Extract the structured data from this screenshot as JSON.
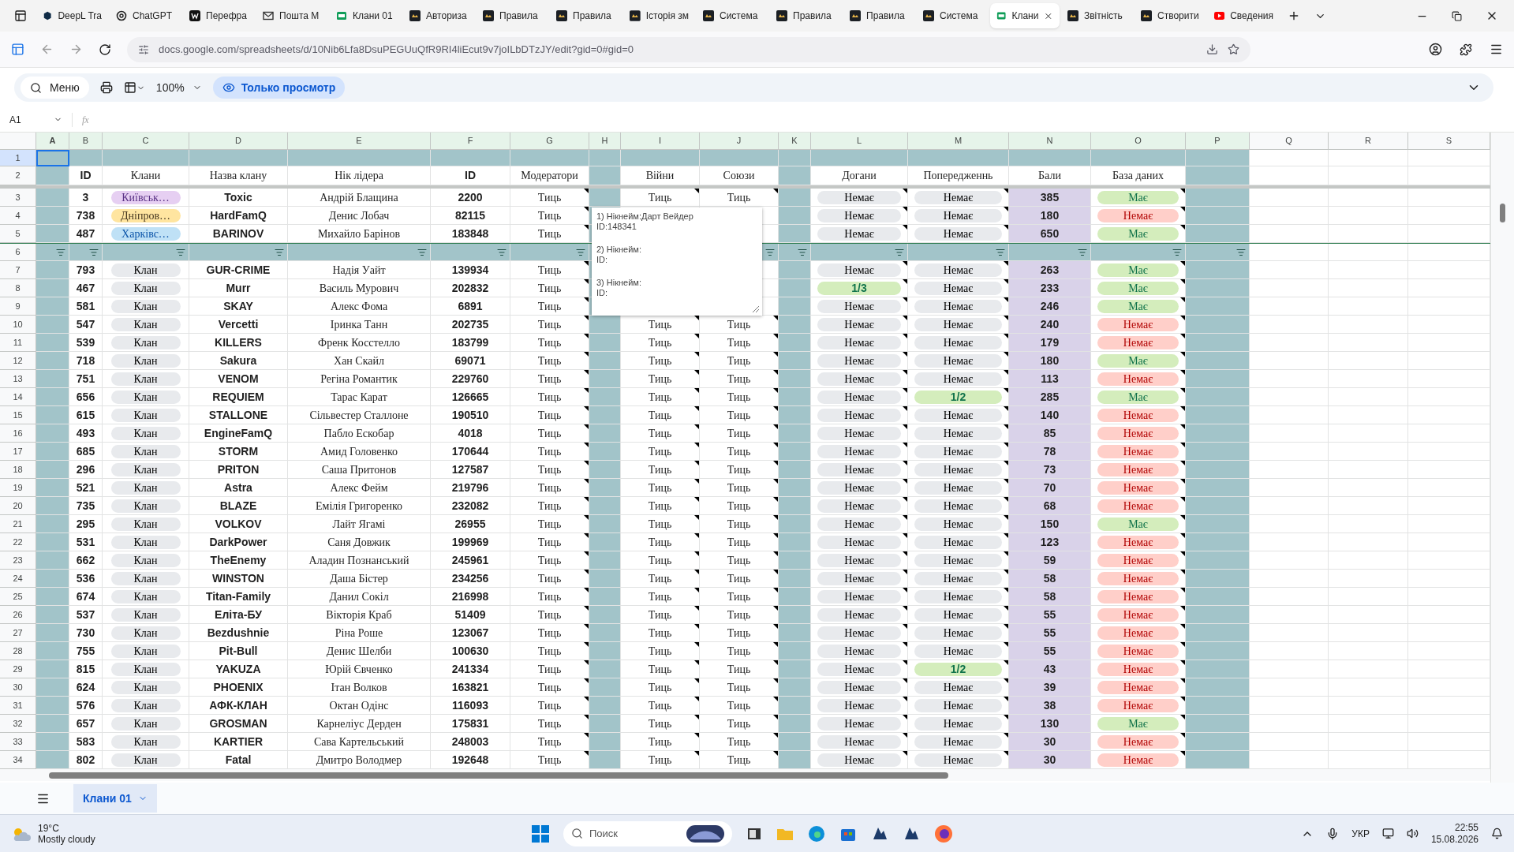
{
  "browser": {
    "tabs": [
      {
        "title": "DeepL Tra",
        "kind": "hexagon",
        "selected": false
      },
      {
        "title": "ChatGPT",
        "kind": "knot",
        "selected": false
      },
      {
        "title": "Перефра",
        "kind": "tile",
        "selected": false
      },
      {
        "title": "Пошта M",
        "kind": "mail",
        "selected": false
      },
      {
        "title": "Клани 01",
        "kind": "sheet",
        "selected": false
      },
      {
        "title": "Авториза",
        "kind": "app",
        "selected": false
      },
      {
        "title": "Правила",
        "kind": "app",
        "selected": false
      },
      {
        "title": "Правила",
        "kind": "app",
        "selected": false
      },
      {
        "title": "Історія зм",
        "kind": "app",
        "selected": false
      },
      {
        "title": "Система",
        "kind": "app",
        "selected": false
      },
      {
        "title": "Правила",
        "kind": "app",
        "selected": false
      },
      {
        "title": "Правила",
        "kind": "app",
        "selected": false
      },
      {
        "title": "Система",
        "kind": "app",
        "selected": false
      },
      {
        "title": "Клани",
        "kind": "sheet",
        "selected": true
      },
      {
        "title": "Звітність",
        "kind": "app",
        "selected": false
      },
      {
        "title": "Створити",
        "kind": "app",
        "selected": false
      },
      {
        "title": "Сведения",
        "kind": "video",
        "selected": false
      }
    ],
    "url": "docs.google.com/spreadsheets/d/10Nib6Lfa8DsuPEGUuQfR9RI4liEcut9v7joILbDTzJY/edit?gid=0#gid=0"
  },
  "toolbar": {
    "menu": "Меню",
    "zoom": "100%",
    "mode": "Только просмотр"
  },
  "formula_bar": {
    "cell": "A1",
    "fx": "fx"
  },
  "sheet": {
    "columns": [
      {
        "letter": "A",
        "highlighted": true,
        "notes": false
      },
      {
        "letter": "B",
        "highlighted": true,
        "notes": false
      },
      {
        "letter": "C",
        "highlighted": true,
        "notes": false
      },
      {
        "letter": "D",
        "highlighted": true,
        "notes": false
      },
      {
        "letter": "E",
        "highlighted": true,
        "notes": false
      },
      {
        "letter": "F",
        "highlighted": true,
        "notes": false
      },
      {
        "letter": "G",
        "highlighted": true,
        "notes": true
      },
      {
        "letter": "H",
        "highlighted": true,
        "notes": false
      },
      {
        "letter": "I",
        "highlighted": true,
        "notes": true
      },
      {
        "letter": "J",
        "highlighted": true,
        "notes": true
      },
      {
        "letter": "K",
        "highlighted": true,
        "notes": false
      },
      {
        "letter": "L",
        "highlighted": true,
        "notes": true
      },
      {
        "letter": "M",
        "highlighted": true,
        "notes": true
      },
      {
        "letter": "N",
        "highlighted": true,
        "notes": false
      },
      {
        "letter": "O",
        "highlighted": true,
        "notes": true
      },
      {
        "letter": "P",
        "highlighted": true,
        "notes": false
      },
      {
        "letter": "Q",
        "highlighted": false,
        "notes": false
      },
      {
        "letter": "R",
        "highlighted": false,
        "notes": false
      },
      {
        "letter": "S",
        "highlighted": false,
        "notes": false
      }
    ],
    "rows": [
      {
        "kind": "band",
        "row": "1"
      },
      {
        "kind": "header",
        "row": "2",
        "labels": {
          "id": "ID",
          "clan": "Клани",
          "clan_name": "Назва клану",
          "leader": "Нік лідера",
          "player_id": "ID",
          "moderators": "Модератори",
          "wars": "Війни",
          "alliances": "Союзи",
          "reprimands": "Догани",
          "warnings": "Попередженнь",
          "points": "Бали",
          "database": "База даних"
        }
      },
      {
        "kind": "data",
        "row": "3",
        "id": "3",
        "clan": {
          "label": "Київськ…",
          "color": "#e6cff2"
        },
        "clan_name": "Toxic",
        "leader": "Андрій Блащина",
        "player_id": "2200",
        "moderators": "Тиць",
        "wars": "Тиць",
        "alliances": "Тиць",
        "reprimands": {
          "text": "Немає",
          "kind": "neutral"
        },
        "warnings": {
          "text": "Немає",
          "kind": "neutral"
        },
        "points": "385",
        "database": {
          "text": "Має",
          "kind": "positive"
        }
      },
      {
        "kind": "data",
        "row": "4",
        "id": "738",
        "clan": {
          "label": "Дніпров…",
          "color": "#ffe5a0"
        },
        "clan_name": "HardFamQ",
        "leader": "Денис Лобач",
        "player_id": "82115",
        "moderators": "Тиць",
        "reprimands": {
          "text": "Немає",
          "kind": "neutral"
        },
        "warnings": {
          "text": "Немає",
          "kind": "neutral"
        },
        "points": "180",
        "database": {
          "text": "Немає",
          "kind": "negative"
        }
      },
      {
        "kind": "data",
        "row": "5",
        "id": "487",
        "clan": {
          "label": "Харківс…",
          "color": "#bfe1f6"
        },
        "clan_name": "BARINOV",
        "leader": "Михайло Барінов",
        "player_id": "183848",
        "moderators": "Тиць",
        "reprimands": {
          "text": "Немає",
          "kind": "neutral"
        },
        "warnings": {
          "text": "Немає",
          "kind": "neutral"
        },
        "points": "650",
        "database": {
          "text": "Має",
          "kind": "positive"
        }
      },
      {
        "kind": "filter",
        "row": "6",
        "filters": [
          true,
          true,
          true,
          true,
          true,
          true,
          true,
          false,
          false,
          true,
          true,
          true,
          true,
          true,
          true,
          true
        ]
      },
      {
        "kind": "data",
        "row": "7",
        "id": "793",
        "clan": {
          "label": "Клан",
          "color": "#e8eaed"
        },
        "clan_name": "GUR-CRIME",
        "leader": "Надія Уайт",
        "player_id": "139934",
        "moderators": "Тиць",
        "reprimands": {
          "text": "Немає",
          "kind": "neutral"
        },
        "warnings": {
          "text": "Немає",
          "kind": "neutral"
        },
        "points": "263",
        "database": {
          "text": "Має",
          "kind": "positive"
        }
      },
      {
        "kind": "data",
        "row": "8",
        "id": "467",
        "clan": {
          "label": "Клан",
          "color": "#e8eaed"
        },
        "clan_name": "Murr",
        "leader": "Василь Мурович",
        "player_id": "202832",
        "moderators": "Тиць",
        "reprimands": {
          "text": "1/3",
          "kind": "positive"
        },
        "warnings": {
          "text": "Немає",
          "kind": "neutral"
        },
        "points": "233",
        "database": {
          "text": "Має",
          "kind": "positive"
        }
      },
      {
        "kind": "data",
        "row": "9",
        "id": "581",
        "clan": {
          "label": "Клан",
          "color": "#e8eaed"
        },
        "clan_name": "SKAY",
        "leader": "Алекс Фома",
        "player_id": "6891",
        "moderators": "Тиць",
        "reprimands": {
          "text": "Немає",
          "kind": "neutral"
        },
        "warnings": {
          "text": "Немає",
          "kind": "neutral"
        },
        "points": "246",
        "database": {
          "text": "Має",
          "kind": "positive"
        }
      },
      {
        "kind": "data",
        "row": "10",
        "id": "547",
        "clan": {
          "label": "Клан",
          "color": "#e8eaed"
        },
        "clan_name": "Vercetti",
        "leader": "Іринка Танн",
        "player_id": "202735",
        "moderators": "Тиць",
        "wars": "Тиць",
        "alliances": "Тиць",
        "reprimands": {
          "text": "Немає",
          "kind": "neutral"
        },
        "warnings": {
          "text": "Немає",
          "kind": "neutral"
        },
        "points": "240",
        "database": {
          "text": "Немає",
          "kind": "negative"
        }
      },
      {
        "kind": "data",
        "row": "11",
        "id": "539",
        "clan": {
          "label": "Клан",
          "color": "#e8eaed"
        },
        "clan_name": "KILLERS",
        "leader": "Френк Косстелло",
        "player_id": "183799",
        "moderators": "Тиць",
        "wars": "Тиць",
        "alliances": "Тиць",
        "reprimands": {
          "text": "Немає",
          "kind": "neutral"
        },
        "warnings": {
          "text": "Немає",
          "kind": "neutral"
        },
        "points": "179",
        "database": {
          "text": "Немає",
          "kind": "negative"
        }
      },
      {
        "kind": "data",
        "row": "12",
        "id": "718",
        "clan": {
          "label": "Клан",
          "color": "#e8eaed"
        },
        "clan_name": "Sakura",
        "leader": "Хан Скайл",
        "player_id": "69071",
        "moderators": "Тиць",
        "wars": "Тиць",
        "alliances": "Тиць",
        "reprimands": {
          "text": "Немає",
          "kind": "neutral"
        },
        "warnings": {
          "text": "Немає",
          "kind": "neutral"
        },
        "points": "180",
        "database": {
          "text": "Має",
          "kind": "positive"
        }
      },
      {
        "kind": "data",
        "row": "13",
        "id": "751",
        "clan": {
          "label": "Клан",
          "color": "#e8eaed"
        },
        "clan_name": "VENOM",
        "leader": "Регіна Романтик",
        "player_id": "229760",
        "moderators": "Тиць",
        "wars": "Тиць",
        "alliances": "Тиць",
        "reprimands": {
          "text": "Немає",
          "kind": "neutral"
        },
        "warnings": {
          "text": "Немає",
          "kind": "neutral"
        },
        "points": "113",
        "database": {
          "text": "Немає",
          "kind": "negative"
        }
      },
      {
        "kind": "data",
        "row": "14",
        "id": "656",
        "clan": {
          "label": "Клан",
          "color": "#e8eaed"
        },
        "clan_name": "REQUIEM",
        "leader": "Тарас Карат",
        "player_id": "126665",
        "moderators": "Тиць",
        "wars": "Тиць",
        "alliances": "Тиць",
        "reprimands": {
          "text": "Немає",
          "kind": "neutral"
        },
        "warnings": {
          "text": "1/2",
          "kind": "positive"
        },
        "points": "285",
        "database": {
          "text": "Має",
          "kind": "positive"
        }
      },
      {
        "kind": "data",
        "row": "15",
        "id": "615",
        "clan": {
          "label": "Клан",
          "color": "#e8eaed"
        },
        "clan_name": "STALLONE",
        "leader": "Сільвестер Сталлоне",
        "player_id": "190510",
        "moderators": "Тиць",
        "wars": "Тиць",
        "alliances": "Тиць",
        "reprimands": {
          "text": "Немає",
          "kind": "neutral"
        },
        "warnings": {
          "text": "Немає",
          "kind": "neutral"
        },
        "points": "140",
        "database": {
          "text": "Немає",
          "kind": "negative"
        }
      },
      {
        "kind": "data",
        "row": "16",
        "id": "493",
        "clan": {
          "label": "Клан",
          "color": "#e8eaed"
        },
        "clan_name": "EngineFamQ",
        "leader": "Пабло Ескобар",
        "player_id": "4018",
        "moderators": "Тиць",
        "wars": "Тиць",
        "alliances": "Тиць",
        "reprimands": {
          "text": "Немає",
          "kind": "neutral"
        },
        "warnings": {
          "text": "Немає",
          "kind": "neutral"
        },
        "points": "85",
        "database": {
          "text": "Немає",
          "kind": "negative"
        }
      },
      {
        "kind": "data",
        "row": "17",
        "id": "685",
        "clan": {
          "label": "Клан",
          "color": "#e8eaed"
        },
        "clan_name": "STORM",
        "leader": "Амид Головенко",
        "player_id": "170644",
        "moderators": "Тиць",
        "wars": "Тиць",
        "alliances": "Тиць",
        "reprimands": {
          "text": "Немає",
          "kind": "neutral"
        },
        "warnings": {
          "text": "Немає",
          "kind": "neutral"
        },
        "points": "78",
        "database": {
          "text": "Немає",
          "kind": "negative"
        }
      },
      {
        "kind": "data",
        "row": "18",
        "id": "296",
        "clan": {
          "label": "Клан",
          "color": "#e8eaed"
        },
        "clan_name": "PRITON",
        "leader": "Саша Притонов",
        "player_id": "127587",
        "moderators": "Тиць",
        "wars": "Тиць",
        "alliances": "Тиць",
        "reprimands": {
          "text": "Немає",
          "kind": "neutral"
        },
        "warnings": {
          "text": "Немає",
          "kind": "neutral"
        },
        "points": "73",
        "database": {
          "text": "Немає",
          "kind": "negative"
        }
      },
      {
        "kind": "data",
        "row": "19",
        "id": "521",
        "clan": {
          "label": "Клан",
          "color": "#e8eaed"
        },
        "clan_name": "Astra",
        "leader": "Алекс Фейм",
        "player_id": "219796",
        "moderators": "Тиць",
        "wars": "Тиць",
        "alliances": "Тиць",
        "reprimands": {
          "text": "Немає",
          "kind": "neutral"
        },
        "warnings": {
          "text": "Немає",
          "kind": "neutral"
        },
        "points": "70",
        "database": {
          "text": "Немає",
          "kind": "negative"
        }
      },
      {
        "kind": "data",
        "row": "20",
        "id": "735",
        "clan": {
          "label": "Клан",
          "color": "#e8eaed"
        },
        "clan_name": "BLAZE",
        "leader": "Емілія Григоренко",
        "player_id": "232082",
        "moderators": "Тиць",
        "wars": "Тиць",
        "alliances": "Тиць",
        "reprimands": {
          "text": "Немає",
          "kind": "neutral"
        },
        "warnings": {
          "text": "Немає",
          "kind": "neutral"
        },
        "points": "68",
        "database": {
          "text": "Немає",
          "kind": "negative"
        }
      },
      {
        "kind": "data",
        "row": "21",
        "id": "295",
        "clan": {
          "label": "Клан",
          "color": "#e8eaed"
        },
        "clan_name": "VOLKOV",
        "leader": "Лайт Ягамі",
        "player_id": "26955",
        "moderators": "Тиць",
        "wars": "Тиць",
        "alliances": "Тиць",
        "reprimands": {
          "text": "Немає",
          "kind": "neutral"
        },
        "warnings": {
          "text": "Немає",
          "kind": "neutral"
        },
        "points": "150",
        "database": {
          "text": "Має",
          "kind": "positive"
        }
      },
      {
        "kind": "data",
        "row": "22",
        "id": "531",
        "clan": {
          "label": "Клан",
          "color": "#e8eaed"
        },
        "clan_name": "DarkPower",
        "leader": "Саня Довжик",
        "player_id": "199969",
        "moderators": "Тиць",
        "wars": "Тиць",
        "alliances": "Тиць",
        "reprimands": {
          "text": "Немає",
          "kind": "neutral"
        },
        "warnings": {
          "text": "Немає",
          "kind": "neutral"
        },
        "points": "123",
        "database": {
          "text": "Немає",
          "kind": "negative"
        }
      },
      {
        "kind": "data",
        "row": "23",
        "id": "662",
        "clan": {
          "label": "Клан",
          "color": "#e8eaed"
        },
        "clan_name": "TheEnemy",
        "leader": "Аладин Познанський",
        "player_id": "245961",
        "moderators": "Тиць",
        "wars": "Тиць",
        "alliances": "Тиць",
        "reprimands": {
          "text": "Немає",
          "kind": "neutral"
        },
        "warnings": {
          "text": "Немає",
          "kind": "neutral"
        },
        "points": "59",
        "database": {
          "text": "Немає",
          "kind": "negative"
        }
      },
      {
        "kind": "data",
        "row": "24",
        "id": "536",
        "clan": {
          "label": "Клан",
          "color": "#e8eaed"
        },
        "clan_name": "WINSTON",
        "leader": "Даша Бістер",
        "player_id": "234256",
        "moderators": "Тиць",
        "wars": "Тиць",
        "alliances": "Тиць",
        "reprimands": {
          "text": "Немає",
          "kind": "neutral"
        },
        "warnings": {
          "text": "Немає",
          "kind": "neutral"
        },
        "points": "58",
        "database": {
          "text": "Немає",
          "kind": "negative"
        }
      },
      {
        "kind": "data",
        "row": "25",
        "id": "674",
        "clan": {
          "label": "Клан",
          "color": "#e8eaed"
        },
        "clan_name": "Titan-Family",
        "leader": "Данил Сокіл",
        "player_id": "216998",
        "moderators": "Тиць",
        "wars": "Тиць",
        "alliances": "Тиць",
        "reprimands": {
          "text": "Немає",
          "kind": "neutral"
        },
        "warnings": {
          "text": "Немає",
          "kind": "neutral"
        },
        "points": "58",
        "database": {
          "text": "Немає",
          "kind": "negative"
        }
      },
      {
        "kind": "data",
        "row": "26",
        "id": "537",
        "clan": {
          "label": "Клан",
          "color": "#e8eaed"
        },
        "clan_name": "Еліта-БУ",
        "leader": "Вікторія Краб",
        "player_id": "51409",
        "moderators": "Тиць",
        "wars": "Тиць",
        "alliances": "Тиць",
        "reprimands": {
          "text": "Немає",
          "kind": "neutral"
        },
        "warnings": {
          "text": "Немає",
          "kind": "neutral"
        },
        "points": "55",
        "database": {
          "text": "Немає",
          "kind": "negative"
        }
      },
      {
        "kind": "data",
        "row": "27",
        "id": "730",
        "clan": {
          "label": "Клан",
          "color": "#e8eaed"
        },
        "clan_name": "Bezdushnie",
        "leader": "Ріна Роше",
        "player_id": "123067",
        "moderators": "Тиць",
        "wars": "Тиць",
        "alliances": "Тиць",
        "reprimands": {
          "text": "Немає",
          "kind": "neutral"
        },
        "warnings": {
          "text": "Немає",
          "kind": "neutral"
        },
        "points": "55",
        "database": {
          "text": "Немає",
          "kind": "negative"
        }
      },
      {
        "kind": "data",
        "row": "28",
        "id": "755",
        "clan": {
          "label": "Клан",
          "color": "#e8eaed"
        },
        "clan_name": "Pit-Bull",
        "leader": "Денис Шелби",
        "player_id": "100630",
        "moderators": "Тиць",
        "wars": "Тиць",
        "alliances": "Тиць",
        "reprimands": {
          "text": "Немає",
          "kind": "neutral"
        },
        "warnings": {
          "text": "Немає",
          "kind": "neutral"
        },
        "points": "55",
        "database": {
          "text": "Немає",
          "kind": "negative"
        }
      },
      {
        "kind": "data",
        "row": "29",
        "id": "815",
        "clan": {
          "label": "Клан",
          "color": "#e8eaed"
        },
        "clan_name": "YAKUZA",
        "leader": "Юрій Євченко",
        "player_id": "241334",
        "moderators": "Тиць",
        "wars": "Тиць",
        "alliances": "Тиць",
        "reprimands": {
          "text": "Немає",
          "kind": "neutral"
        },
        "warnings": {
          "text": "1/2",
          "kind": "positive"
        },
        "points": "43",
        "database": {
          "text": "Немає",
          "kind": "negative"
        }
      },
      {
        "kind": "data",
        "row": "30",
        "id": "624",
        "clan": {
          "label": "Клан",
          "color": "#e8eaed"
        },
        "clan_name": "PHOENIX",
        "leader": "Ітан Волков",
        "player_id": "163821",
        "moderators": "Тиць",
        "wars": "Тиць",
        "alliances": "Тиць",
        "reprimands": {
          "text": "Немає",
          "kind": "neutral"
        },
        "warnings": {
          "text": "Немає",
          "kind": "neutral"
        },
        "points": "39",
        "database": {
          "text": "Немає",
          "kind": "negative"
        }
      },
      {
        "kind": "data",
        "row": "31",
        "id": "576",
        "clan": {
          "label": "Клан",
          "color": "#e8eaed"
        },
        "clan_name": "АФК-КЛАН",
        "leader": "Октан Одінс",
        "player_id": "116093",
        "moderators": "Тиць",
        "wars": "Тиць",
        "alliances": "Тиць",
        "reprimands": {
          "text": "Немає",
          "kind": "neutral"
        },
        "warnings": {
          "text": "Немає",
          "kind": "neutral"
        },
        "points": "38",
        "database": {
          "text": "Немає",
          "kind": "negative"
        }
      },
      {
        "kind": "data",
        "row": "32",
        "id": "657",
        "clan": {
          "label": "Клан",
          "color": "#e8eaed"
        },
        "clan_name": "GROSMAN",
        "leader": "Карнеліус Дерден",
        "player_id": "175831",
        "moderators": "Тиць",
        "wars": "Тиць",
        "alliances": "Тиць",
        "reprimands": {
          "text": "Немає",
          "kind": "neutral"
        },
        "warnings": {
          "text": "Немає",
          "kind": "neutral"
        },
        "points": "130",
        "database": {
          "text": "Має",
          "kind": "positive"
        }
      },
      {
        "kind": "data",
        "row": "33",
        "id": "583",
        "clan": {
          "label": "Клан",
          "color": "#e8eaed"
        },
        "clan_name": "KARTIER",
        "leader": "Сава Картельський",
        "player_id": "248003",
        "moderators": "Тиць",
        "wars": "Тиць",
        "alliances": "Тиць",
        "reprimands": {
          "text": "Немає",
          "kind": "neutral"
        },
        "warnings": {
          "text": "Немає",
          "kind": "neutral"
        },
        "points": "30",
        "database": {
          "text": "Немає",
          "kind": "negative"
        }
      },
      {
        "kind": "data",
        "row": "34",
        "id": "802",
        "clan": {
          "label": "Клан",
          "color": "#e8eaed"
        },
        "clan_name": "Fatal",
        "leader": "Дмитро Володмер",
        "player_id": "192648",
        "moderators": "Тиць",
        "wars": "Тиць",
        "alliances": "Тиць",
        "reprimands": {
          "text": "Немає",
          "kind": "neutral"
        },
        "warnings": {
          "text": "Немає",
          "kind": "neutral"
        },
        "points": "30",
        "database": {
          "text": "Немає",
          "kind": "negative"
        }
      }
    ],
    "comment": [
      "1) Нікнейм:Дарт Вейдер",
      "ID:148341",
      "2) Нікнейм:",
      "ID:",
      "3) Нікнейм:",
      "ID:"
    ],
    "sheet_tab": {
      "label": "Клани 01",
      "selected": true
    }
  },
  "taskbar": {
    "temperature": "19°C",
    "weather": "Mostly cloudy",
    "search": "Поиск",
    "language": "УКР",
    "time": "22:55",
    "date": "15.08.2026"
  }
}
